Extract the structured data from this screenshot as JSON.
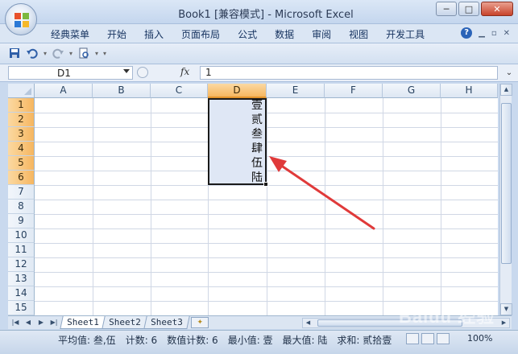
{
  "window": {
    "title": "Book1  [兼容模式] - Microsoft Excel",
    "minimize": "─",
    "maximize": "□",
    "close": "✕"
  },
  "ribbon": {
    "tabs": [
      "经典菜单",
      "开始",
      "插入",
      "页面布局",
      "公式",
      "数据",
      "审阅",
      "视图",
      "开发工具"
    ],
    "help": "?"
  },
  "formula_bar": {
    "name_box": "D1",
    "fx": "fx",
    "value": "1"
  },
  "grid": {
    "columns": [
      "A",
      "B",
      "C",
      "D",
      "E",
      "F",
      "G",
      "H"
    ],
    "selected_column": "D",
    "rows": [
      "1",
      "2",
      "3",
      "4",
      "5",
      "6",
      "7",
      "8",
      "9",
      "10",
      "11",
      "12",
      "13",
      "14",
      "15"
    ],
    "selected_rows": [
      "1",
      "2",
      "3",
      "4",
      "5",
      "6"
    ],
    "cells_D": [
      "壹",
      "贰",
      "叁",
      "肆",
      "伍",
      "陆"
    ]
  },
  "sheets": {
    "tabs": [
      "Sheet1",
      "Sheet2",
      "Sheet3"
    ],
    "active": "Sheet1"
  },
  "status": {
    "average": "平均值: 叁,伍",
    "count": "计数: 6",
    "numeric_count": "数值计数: 6",
    "min": "最小值: 壹",
    "max": "最大值: 陆",
    "sum": "求和: 贰拾壹",
    "zoom": "100%"
  },
  "watermark": "Baidu 经验",
  "colors": {
    "accent_selection": "#f6b660",
    "annotation_arrow": "#e03a3a"
  }
}
